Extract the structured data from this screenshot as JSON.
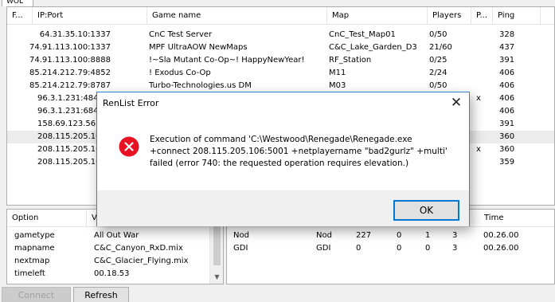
{
  "tab": {
    "label": "WOL"
  },
  "servers": {
    "columns": [
      "F...",
      "IP:Port",
      "Game name",
      "Map",
      "Players",
      "P...",
      "Ping"
    ],
    "rows": [
      {
        "flag": "",
        "ip": "64.31.35.10:1337",
        "name": "CnC Test Server",
        "map": "CnC_Test_Map01",
        "players": "0/50",
        "p": "",
        "ping": "328"
      },
      {
        "flag": "",
        "ip": "74.91.113.100:1337",
        "name": "MPF UltraAOW NewMaps",
        "map": "C&C_Lake_Garden_D3",
        "players": "21/60",
        "p": "",
        "ping": "437"
      },
      {
        "flag": "",
        "ip": "74.91.113.100:8888",
        "name": "!~Sla Mutant Co-Op~! HappyNewYear!",
        "map": "RF_Station",
        "players": "0/25",
        "p": "",
        "ping": "391"
      },
      {
        "flag": "",
        "ip": "85.214.212.79:4852",
        "name": "! Exodus Co-Op",
        "map": "M11",
        "players": "2/24",
        "p": "",
        "ping": "406"
      },
      {
        "flag": "",
        "ip": "85.214.212.79:8787",
        "name": "Turbo-Technologies.us DM",
        "map": "M03",
        "players": "0/50",
        "p": "",
        "ping": "406"
      },
      {
        "flag": "",
        "ip": "96.3.1.231:484",
        "name": "",
        "map": "",
        "players": "",
        "p": "x",
        "ping": "406"
      },
      {
        "flag": "",
        "ip": "96.3.1.231:684",
        "name": "",
        "map": "",
        "players": "",
        "p": "",
        "ping": "406"
      },
      {
        "flag": "",
        "ip": "158.69.123.56:",
        "name": "",
        "map": "",
        "players": "",
        "p": "",
        "ping": "391"
      },
      {
        "flag": "",
        "ip": "208.115.205.10",
        "name": "",
        "map": "",
        "players": "",
        "p": "",
        "ping": "360"
      },
      {
        "flag": "",
        "ip": "208.115.205.10",
        "name": "",
        "map": "",
        "players": "",
        "p": "x",
        "ping": "360"
      },
      {
        "flag": "",
        "ip": "208.115.205.10",
        "name": "",
        "map": "",
        "players": "",
        "p": "",
        "ping": "359"
      }
    ]
  },
  "options": {
    "columns": [
      "Option",
      "V"
    ],
    "rows": [
      {
        "option": "gametype",
        "value": "All Out War"
      },
      {
        "option": "mapname",
        "value": "C&C_Canyon_RxD.mix"
      },
      {
        "option": "nextmap",
        "value": "C&C_Glacier_Flying.mix"
      },
      {
        "option": "timeleft",
        "value": "00.18.53"
      }
    ]
  },
  "teams": {
    "time_header": "Time",
    "rows": [
      {
        "name": "Nod",
        "team": "Nod",
        "score": "227",
        "a": "0",
        "b": "1",
        "c": "3",
        "time": "00.26.00"
      },
      {
        "name": "GDI",
        "team": "GDI",
        "score": "0",
        "a": "0",
        "b": "0",
        "c": "3",
        "time": "00.26.00"
      }
    ]
  },
  "buttons": {
    "connect": "Connect",
    "refresh": "Refresh"
  },
  "dialog": {
    "title": "RenList Error",
    "message_line1": "Execution of command 'C:\\Westwood\\Renegade\\Renegade.exe",
    "message_line2": "+connect 208.115.205.106:5001 +netplayername \"bad2gurlz\" +multi'",
    "message_line3": "failed (error 740: the requested operation requires elevation.)",
    "ok_label": "OK",
    "close_glyph": "✕",
    "colors": {
      "error_icon": "#e81123",
      "ok_border": "#0078d7",
      "window_border": "#3a7fd0"
    }
  }
}
